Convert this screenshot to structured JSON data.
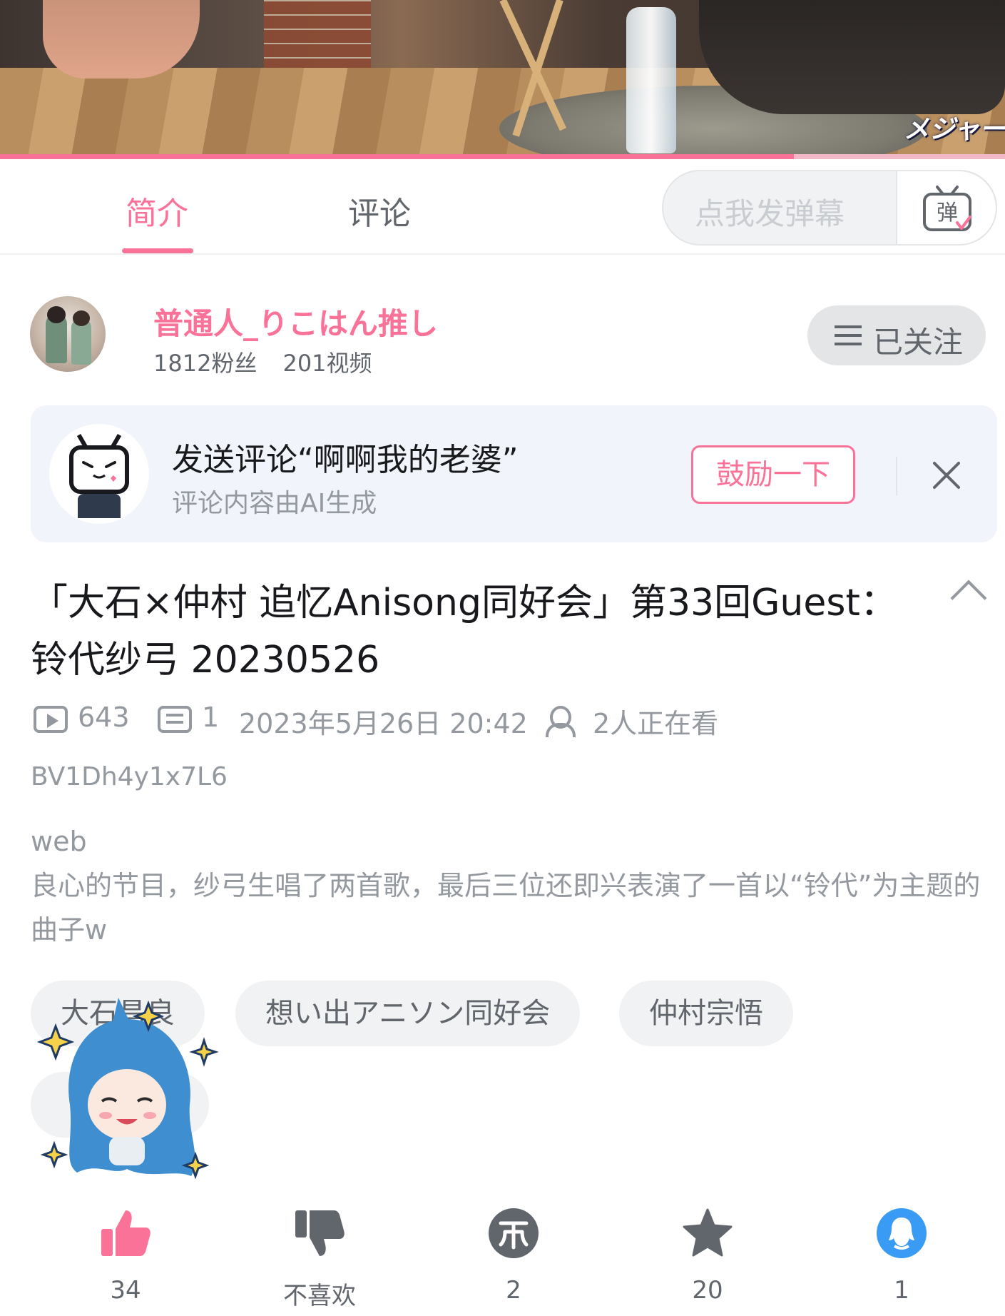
{
  "video": {
    "caption": "メジャー",
    "progress_fraction": 0.79
  },
  "tabs": [
    {
      "label": "简介",
      "active": true
    },
    {
      "label": "评论",
      "active": false
    }
  ],
  "danmaku": {
    "placeholder": "点我发弹幕",
    "button_label": "弹"
  },
  "uploader": {
    "name": "普通人_りこはん推し",
    "fans": "1812粉丝",
    "videos": "201视频",
    "follow_label": "已关注"
  },
  "ai_comment": {
    "title": "发送评论“啊啊我的老婆”",
    "subtitle": "评论内容由AI生成",
    "button_label": "鼓励一下"
  },
  "video_info": {
    "title": "「大石×仲村 追忆Anisong同好会」第33回Guest：铃代纱弓  20230526",
    "views": "643",
    "danmaku_count": "1",
    "publish_time": "2023年5月26日 20:42",
    "watching": "2人正在看",
    "bvid": "BV1Dh4y1x7L6",
    "source": "web",
    "description": "良心的节目，纱弓生唱了两首歌，最后三位还即兴表演了一首以“铃代”为主题的曲子w"
  },
  "tags": [
    "大石昌良",
    "想い出アニソン同好会",
    "仲村宗悟"
  ],
  "actions": {
    "like_count": "34",
    "dislike_label": "不喜欢",
    "coin_count": "2",
    "favorite_count": "20",
    "share_count": "1"
  },
  "colors": {
    "accent": "#fb7299",
    "text_primary": "#18191c",
    "text_secondary": "#61666d",
    "text_muted": "#9499a0",
    "share_blue": "#3a9bf5",
    "coin_gray": "#61666d"
  }
}
